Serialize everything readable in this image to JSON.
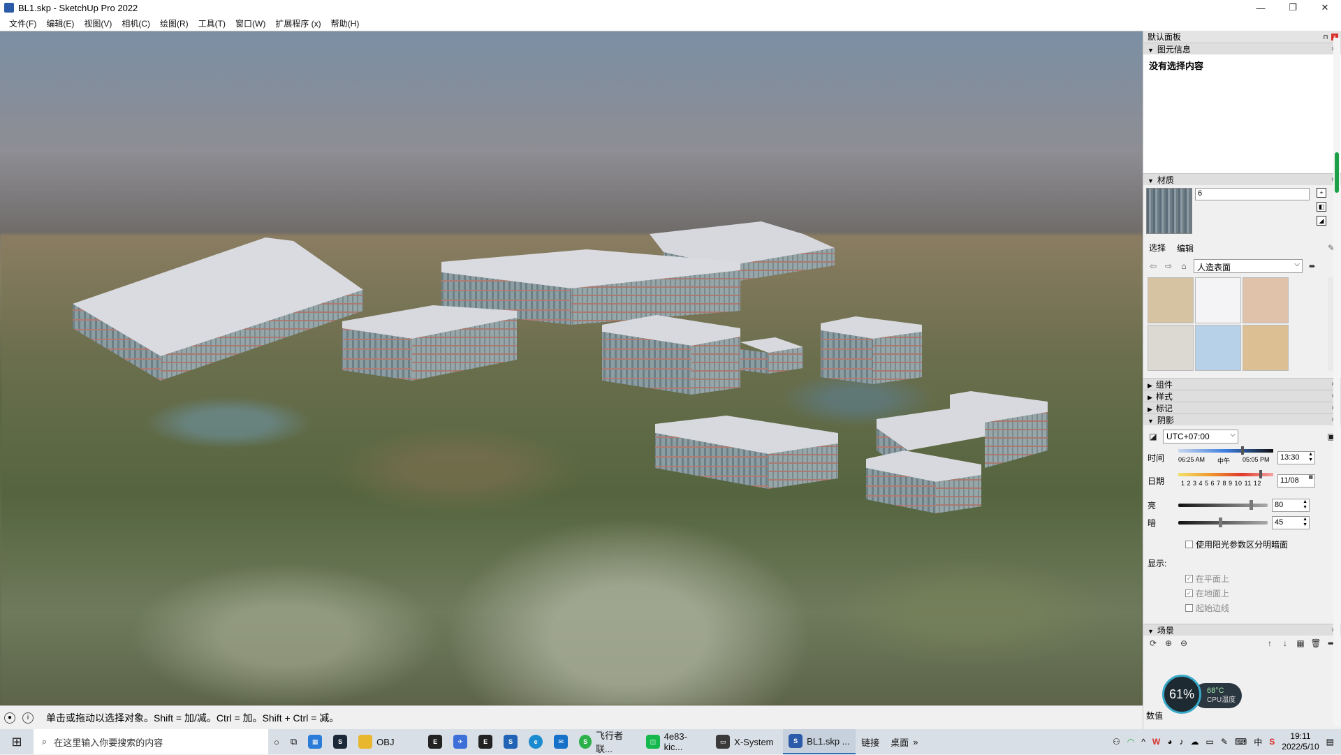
{
  "window": {
    "title": "BL1.skp - SketchUp Pro 2022",
    "minimize": "—",
    "maximize": "❐",
    "close": "✕"
  },
  "menu": [
    "文件(F)",
    "编辑(E)",
    "视图(V)",
    "相机(C)",
    "绘图(R)",
    "工具(T)",
    "窗口(W)",
    "扩展程序 (x)",
    "帮助(H)"
  ],
  "status": {
    "text": "单击或拖动以选择对象。Shift = 加/减。Ctrl = 加。Shift + Ctrl = 减。"
  },
  "tray": {
    "title": "默认面板",
    "entity_info": {
      "header": "图元信息",
      "body": "没有选择内容"
    },
    "materials": {
      "header": "材质",
      "name_value": "6",
      "tabs": [
        "选择",
        "编辑"
      ],
      "collection": "人造表面",
      "swatches": [
        "#d6c3a2",
        "#f4f4f6",
        "#e0c2ab",
        "#dcd8d2",
        "#b7d2e8",
        "#dcbf93"
      ]
    },
    "collapsed_panels": [
      "组件",
      "样式",
      "标记"
    ],
    "shadows": {
      "header": "阴影",
      "timezone": "UTC+07:00",
      "time_label": "时间",
      "time_start": "06:25 AM",
      "time_mid": "中午",
      "time_end": "05:05 PM",
      "time_value": "13:30",
      "date_label": "日期",
      "months": "1 2 3 4 5 6 7 8 9 10 11 12",
      "date_value": "11/08",
      "light_label": "亮",
      "light_value": "80",
      "dark_label": "暗",
      "dark_value": "45",
      "use_sun_label": "使用阳光参数区分明暗面",
      "display_label": "显示:",
      "on_faces": "在平面上",
      "on_ground": "在地面上",
      "from_edges": "起始边线"
    },
    "scenes": {
      "header": "场景"
    },
    "bottom_label": "数值"
  },
  "cpu_widget": {
    "percent": "61%",
    "temp": "68°C",
    "label": "CPU温度"
  },
  "taskbar": {
    "search_placeholder": "在这里输入你要搜索的内容",
    "apps": [
      {
        "label": "OBJ",
        "color": "#e8b72d"
      },
      {
        "label": "飞行者联...",
        "color": "#2bb04a"
      },
      {
        "label": "4e83-kic...",
        "color": "#15b84c"
      },
      {
        "label": "X-System",
        "color": "#3a3a3a"
      },
      {
        "label": "BL1.skp ...",
        "color": "#2b5aa8"
      }
    ],
    "quick_links": [
      "链接",
      "桌面"
    ],
    "ime": "中",
    "time": "19:11",
    "date": "2022/5/10"
  }
}
